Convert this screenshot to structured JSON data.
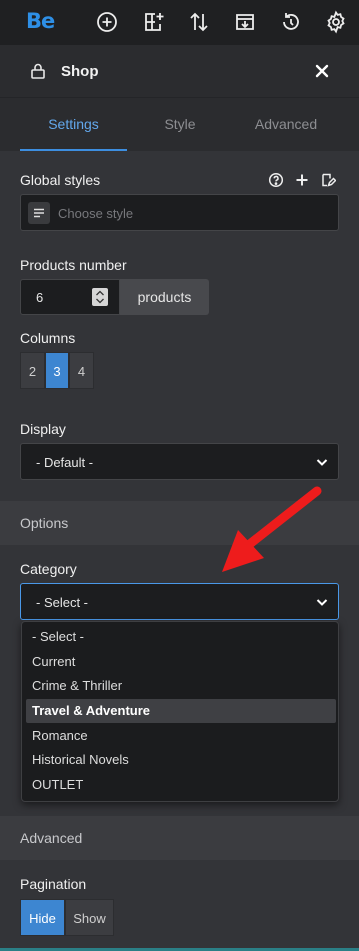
{
  "toolbar": {
    "logo": "Be",
    "icons": [
      "add-circle-icon",
      "add-layout-icon",
      "sort-arrows-icon",
      "import-template-icon",
      "history-icon",
      "gear-icon"
    ]
  },
  "header": {
    "title": "Shop"
  },
  "tabs": [
    {
      "label": "Settings",
      "active": true
    },
    {
      "label": "Style",
      "active": false
    },
    {
      "label": "Advanced",
      "active": false
    }
  ],
  "global_styles": {
    "label": "Global styles",
    "placeholder": "Choose style"
  },
  "products_number": {
    "label": "Products number",
    "value": "6",
    "unit": "products"
  },
  "columns": {
    "label": "Columns",
    "options": [
      "2",
      "3",
      "4"
    ],
    "selected": "3"
  },
  "display": {
    "label": "Display",
    "value": "- Default -"
  },
  "options_section": {
    "title": "Options"
  },
  "category": {
    "label": "Category",
    "value": "- Select -",
    "options": [
      "- Select -",
      "Current",
      "Crime & Thriller",
      "Travel & Adventure",
      "Romance",
      "Historical Novels",
      "OUTLET"
    ],
    "highlighted": "Travel & Adventure"
  },
  "advanced_section": {
    "title": "Advanced"
  },
  "pagination": {
    "label": "Pagination",
    "options": [
      "Hide",
      "Show"
    ],
    "selected": "Hide"
  },
  "colors": {
    "accent": "#3d86d1",
    "annotation_arrow": "#ee1c1c",
    "logo": "#2e8fe6"
  }
}
